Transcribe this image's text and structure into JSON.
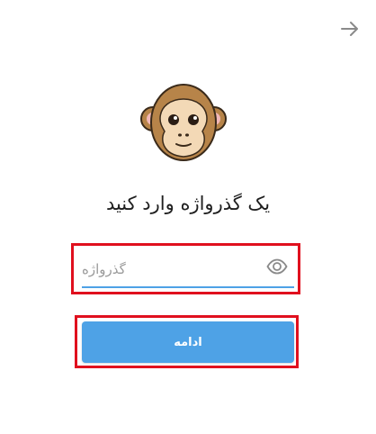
{
  "header": {
    "back_icon": "arrow-right-icon"
  },
  "hero": {
    "icon": "see-no-evil-monkey-icon"
  },
  "title": "یک گذرواژه وارد کنید",
  "password": {
    "placeholder": "گذرواژه",
    "value": "",
    "toggle_icon": "eye-icon"
  },
  "continue_button": {
    "label": "ادامه"
  },
  "colors": {
    "accent": "#4ea2e6",
    "highlight": "#e0101e",
    "background": "#ffffff",
    "title_text": "#1f1f1f",
    "placeholder_text": "#9a9a9a"
  }
}
